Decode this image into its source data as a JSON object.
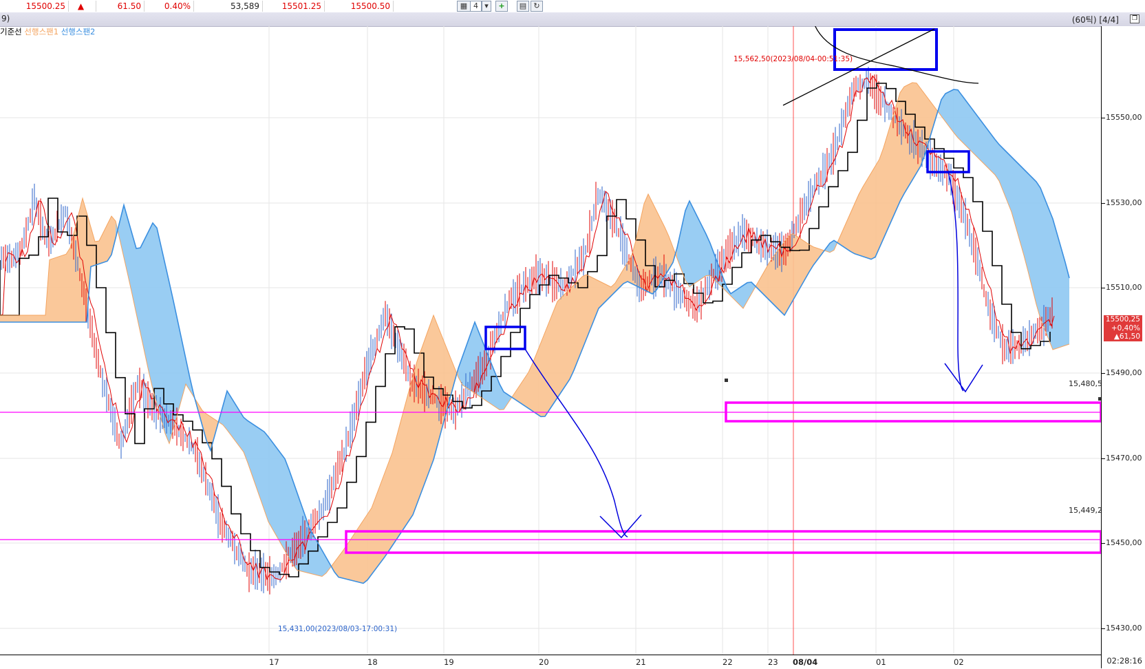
{
  "quote_bar": {
    "last_price": "15500.25",
    "change_arrow": "▲",
    "change": "61.50",
    "change_pct": "0.40%",
    "volume": "53,589",
    "ask": "15501.25",
    "bid": "15500.50"
  },
  "toolbar": {
    "layout_count": "4"
  },
  "title_bar": {
    "title": "9)",
    "ticks_info": "(60틱) [4/4]"
  },
  "legend": {
    "base_line": "기준선",
    "span1": "선행스팬1",
    "span2": "선행스팬2"
  },
  "y_axis": {
    "labels": [
      "15550,00",
      "15530,00",
      "15510,00",
      "15490,00",
      "15470,00",
      "15450,00",
      "15430,00"
    ]
  },
  "x_axis": {
    "labels": [
      "17",
      "18",
      "19",
      "20",
      "21",
      "22",
      "23",
      "08/04",
      "01",
      "02"
    ],
    "time": "02:28:16"
  },
  "price_box": {
    "price": "15500,25",
    "pct": "+0,40%",
    "change": "▲61,50"
  },
  "annotations": {
    "high": "15,562,50(2023/08/04-00:51:35)",
    "low": "15,431,00(2023/08/03-17:00:31)",
    "hline_upper": "15,480,5",
    "hline_lower": "15,449,2"
  },
  "colors": {
    "up_red": "#e00000",
    "span1_orange": "#f4a460",
    "span2_blue": "#3b8fe0",
    "highlight_magenta": "#ff00ff",
    "box_blue": "#0000ee",
    "session_line": "#ff4040"
  },
  "icons": [
    "grid-layout-icon",
    "dropdown-arrow-icon",
    "add-icon",
    "save-icon",
    "refresh-icon",
    "window-restore-icon"
  ]
}
